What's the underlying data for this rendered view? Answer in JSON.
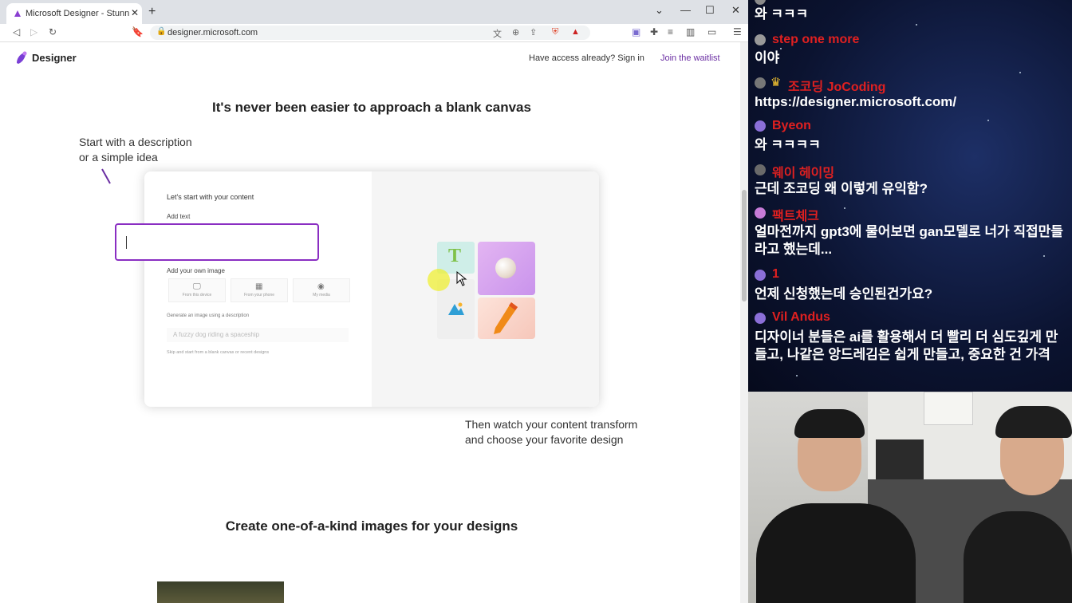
{
  "browser": {
    "tab_title": "Microsoft Designer - Stunning designs",
    "url": "designer.microsoft.com"
  },
  "site": {
    "brand": "Designer",
    "signin": "Have access already? Sign in",
    "waitlist": "Join the waitlist",
    "heading": "It's never been easier to approach a blank canvas",
    "desc_line1": "Start with a description",
    "desc_line2": "or a simple idea",
    "card": {
      "title": "Let's start with your content",
      "add_text_label": "Add text",
      "add_image_label": "Add your own image",
      "options": [
        "From this device",
        "From your phone",
        "My media"
      ],
      "generate_label": "Generate an image using a description",
      "generate_placeholder": "A fuzzy dog riding a spaceship",
      "skip_text": "Skip and start from a blank canvas or recent designs"
    },
    "then_line1": "Then watch your content transform",
    "then_line2": "and choose your favorite design",
    "heading2": "Create one-of-a-kind images for your designs"
  },
  "chat": {
    "messages": [
      {
        "user": "",
        "text": "와 ㅋㅋㅋ"
      },
      {
        "user": "step one more",
        "text": "이야"
      },
      {
        "user": "조코딩 JoCoding",
        "text": "https://designer.microsoft.com/"
      },
      {
        "user": "Byeon",
        "text": "와 ㅋㅋㅋㅋ"
      },
      {
        "user": "웨이 헤이밍",
        "text": "근데 조코딩 왜 이렇게 유익함?"
      },
      {
        "user": "팩트체크",
        "text": "얼마전까지 gpt3에 물어보면 gan모델로 너가 직접만들라고 했는데..."
      },
      {
        "user": "1",
        "text": "언제 신청했는데 승인된건가요?"
      },
      {
        "user": "Vil Andus",
        "text": "디자이너 분들은 ai를 활용해서 더 빨리 더 심도깊게 만들고, 나같은 앙드레김은 쉽게 만들고, 중요한 건 가격"
      }
    ]
  }
}
